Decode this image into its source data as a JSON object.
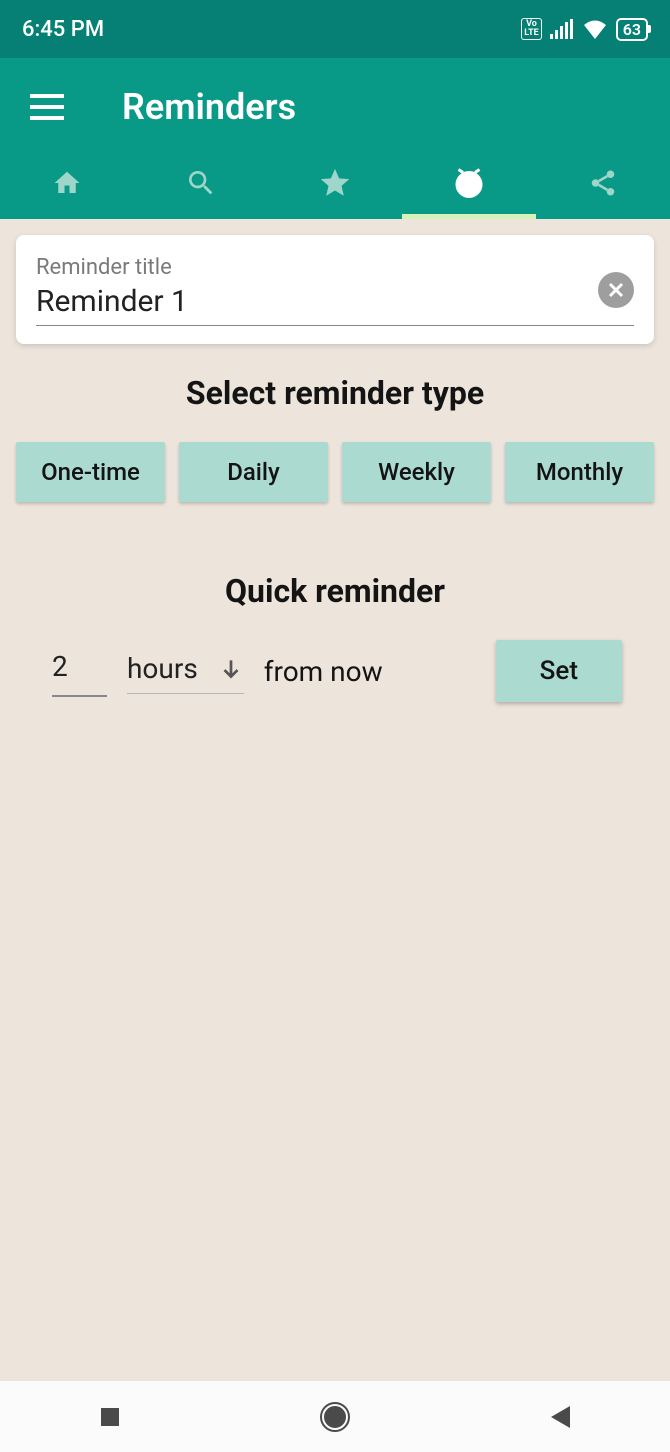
{
  "status": {
    "time": "6:45 PM",
    "battery": "63"
  },
  "appbar": {
    "title": "Reminders"
  },
  "title_input": {
    "label": "Reminder title",
    "value": "Reminder 1"
  },
  "section1": "Select reminder type",
  "types": [
    "One-time",
    "Daily",
    "Weekly",
    "Monthly"
  ],
  "section2": "Quick reminder",
  "quick": {
    "num": "2",
    "unit": "hours",
    "suffix": "from now",
    "set": "Set"
  }
}
